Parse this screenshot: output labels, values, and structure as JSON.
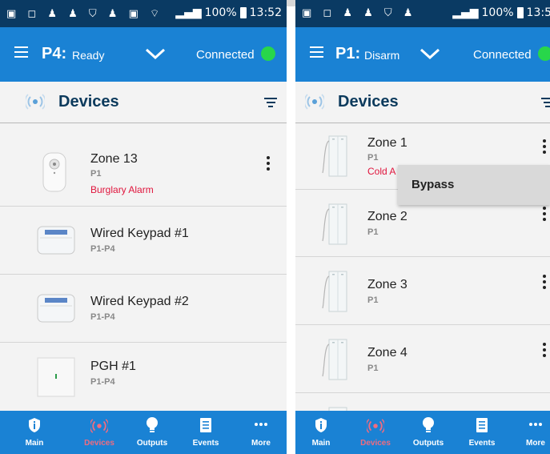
{
  "left": {
    "status_bar": {
      "battery": "100%",
      "time": "13:52"
    },
    "app_bar": {
      "panel": "P4:",
      "panel_status": "Ready",
      "connection": "Connected"
    },
    "section_title": "Devices",
    "devices": [
      {
        "name": "Zone 13",
        "partition": "P1",
        "alarm": "Burglary Alarm",
        "image": "motion-sensor"
      },
      {
        "name": "Wired Keypad #1",
        "partition": "P1-P4",
        "image": "keypad"
      },
      {
        "name": "Wired Keypad #2",
        "partition": "P1-P4",
        "image": "keypad"
      },
      {
        "name": "PGH #1",
        "partition": "P1-P4",
        "image": "pgh-module"
      }
    ],
    "nav": [
      {
        "label": "Main",
        "icon": "shield-info-icon"
      },
      {
        "label": "Devices",
        "icon": "devices-signal-icon",
        "active": true
      },
      {
        "label": "Outputs",
        "icon": "lightbulb-icon"
      },
      {
        "label": "Events",
        "icon": "document-icon"
      },
      {
        "label": "More",
        "icon": "more-dots-icon"
      }
    ]
  },
  "right": {
    "status_bar": {
      "battery": "100%",
      "time": "13:5"
    },
    "app_bar": {
      "panel": "P1:",
      "panel_status": "Disarm",
      "connection": "Connected"
    },
    "section_title": "Devices",
    "devices": [
      {
        "name": "Zone 1",
        "partition": "P1",
        "alarm": "Cold A",
        "image": "door-contact"
      },
      {
        "name": "Zone 2",
        "partition": "P1",
        "image": "door-contact"
      },
      {
        "name": "Zone 3",
        "partition": "P1",
        "image": "door-contact"
      },
      {
        "name": "Zone 4",
        "partition": "P1",
        "image": "door-contact"
      }
    ],
    "context_menu": {
      "item": "Bypass"
    },
    "nav": [
      {
        "label": "Main",
        "icon": "shield-info-icon"
      },
      {
        "label": "Devices",
        "icon": "devices-signal-icon",
        "active": true
      },
      {
        "label": "Outputs",
        "icon": "lightbulb-icon"
      },
      {
        "label": "Events",
        "icon": "document-icon"
      },
      {
        "label": "More",
        "icon": "more-dots-icon"
      }
    ]
  },
  "colors": {
    "status_bar": "#0a3a63",
    "app_bar": "#1a82d4",
    "connected_dot": "#28d64a",
    "alarm_text": "#e0143c",
    "active_nav": "#f06c80",
    "title_text": "#0c3a5c"
  }
}
